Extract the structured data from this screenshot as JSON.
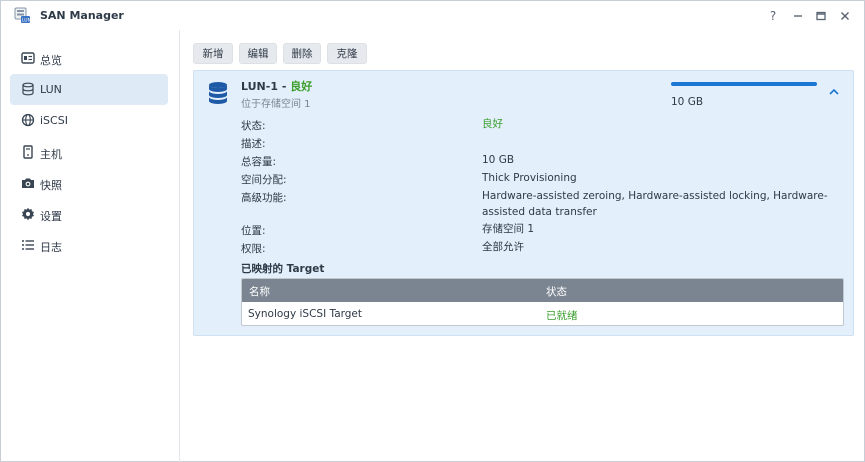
{
  "app": {
    "title": "SAN Manager"
  },
  "window_controls": {
    "help": "?",
    "minimize": "—",
    "maximize": "□",
    "close": "✕"
  },
  "sidebar": {
    "items": [
      {
        "label": "总览",
        "icon": "overview-icon"
      },
      {
        "label": "LUN",
        "icon": "lun-icon",
        "active": true
      },
      {
        "label": "iSCSI",
        "icon": "iscsi-icon"
      },
      {
        "label": "主机",
        "icon": "host-icon"
      },
      {
        "label": "快照",
        "icon": "camera-icon"
      },
      {
        "label": "设置",
        "icon": "gear-icon"
      },
      {
        "label": "日志",
        "icon": "log-icon"
      }
    ]
  },
  "toolbar": {
    "add": "新增",
    "edit": "编辑",
    "delete": "删除",
    "clone": "克隆"
  },
  "lun": {
    "name": "LUN-1",
    "separator": " - ",
    "status": "良好",
    "location_line": "位于存储空间 1",
    "capacity_text": "10 GB",
    "capacity_used_fraction": 1.0,
    "colors": {
      "accent": "#1b77d3",
      "good": "#3b9e2d",
      "panel": "#e3effb"
    },
    "details": [
      {
        "label": "状态:",
        "value": "良好"
      },
      {
        "label": "描述:",
        "value": ""
      },
      {
        "label": "总容量:",
        "value": "10 GB"
      },
      {
        "label": "空间分配:",
        "value": "Thick Provisioning"
      },
      {
        "label": "高级功能:",
        "value_line1": "Hardware-assisted zeroing, Hardware-assisted locking, Hardware-",
        "value_line2": "assisted data transfer"
      },
      {
        "label": "位置:",
        "value": "存储空间 1"
      },
      {
        "label": "权限:",
        "value": "全部允许"
      }
    ],
    "mapped_target_title": "已映射的 Target",
    "table": {
      "headers": [
        "名称",
        "状态"
      ],
      "rows": [
        {
          "name": "Synology iSCSI Target",
          "status": "已就绪"
        }
      ]
    }
  }
}
